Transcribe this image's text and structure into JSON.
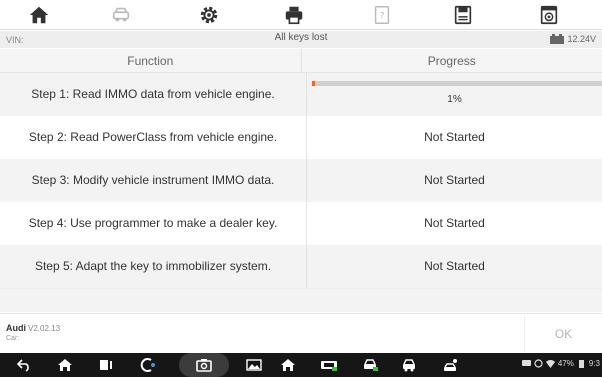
{
  "toolbar": {
    "icons": [
      "home-icon",
      "vehicle-icon",
      "settings-icon",
      "print-icon",
      "help-icon",
      "save-icon",
      "screenshot-icon"
    ]
  },
  "info": {
    "vin_label": "VIN:",
    "title": "All keys lost",
    "battery_voltage": "12.24V"
  },
  "table": {
    "headers": {
      "function": "Function",
      "progress": "Progress"
    },
    "rows": [
      {
        "function": "Step 1: Read IMMO data from vehicle engine.",
        "progress": "1%",
        "progress_value": 1
      },
      {
        "function": "Step 2: Read PowerClass from vehicle engine.",
        "progress": "Not Started"
      },
      {
        "function": "Step 3: Modify vehicle instrument IMMO data.",
        "progress": "Not Started"
      },
      {
        "function": "Step 4: Use programmer to make a dealer key.",
        "progress": "Not Started"
      },
      {
        "function": "Step 5: Adapt the key to immobilizer system.",
        "progress": "Not Started"
      }
    ]
  },
  "footer": {
    "brand": "Audi",
    "version": "V2.02.13",
    "car_label": "Car:",
    "ok_label": "OK"
  },
  "navbar": {
    "status_text": "47%",
    "clock": "9:3"
  },
  "colors": {
    "progress_fill": "#f26522",
    "progress_track": "#cfcfcf",
    "navbar_bg": "#161616"
  }
}
